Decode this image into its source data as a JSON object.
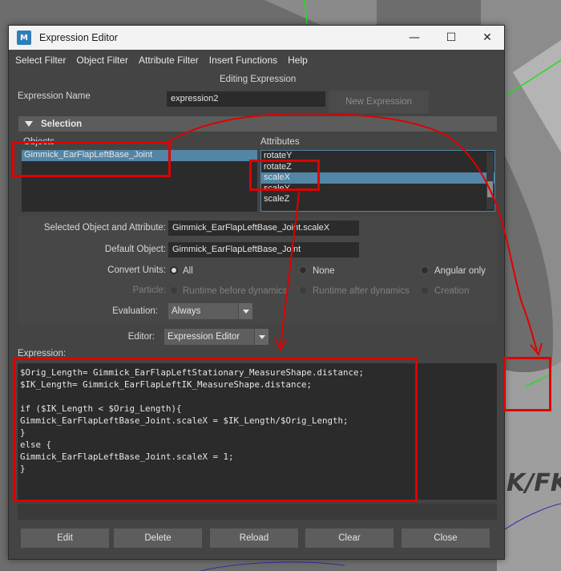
{
  "window": {
    "title": "Expression Editor",
    "app_icon": "M",
    "controls": {
      "minimize": "—",
      "maximize": "☐",
      "close": "✕"
    }
  },
  "menu": [
    "Select Filter",
    "Object Filter",
    "Attribute Filter",
    "Insert Functions",
    "Help"
  ],
  "header": {
    "editing_label": "Editing Expression"
  },
  "expression_name": {
    "label": "Expression Name",
    "value": "expression2",
    "new_button": "New Expression"
  },
  "selection": {
    "title": "Selection",
    "objects_label": "Objects",
    "objects": [
      "Gimmick_EarFlapLeftBase_Joint"
    ],
    "attributes_label": "Attributes",
    "attributes": [
      "rotateY",
      "rotateZ",
      "scaleX",
      "scaleY",
      "scaleZ"
    ],
    "selected_attribute": "scaleX"
  },
  "details": {
    "selected_label": "Selected Object and Attribute:",
    "selected_value": "Gimmick_EarFlapLeftBase_Joint.scaleX",
    "default_label": "Default Object:",
    "default_value": "Gimmick_EarFlapLeftBase_Joint",
    "convert_units_label": "Convert Units:",
    "convert_units_options": [
      "All",
      "None",
      "Angular only"
    ],
    "particle_label": "Particle:",
    "particle_options": [
      "Runtime before dynamics",
      "Runtime after dynamics",
      "Creation"
    ],
    "evaluation_label": "Evaluation:",
    "evaluation_value": "Always",
    "editor_label": "Editor:",
    "editor_value": "Expression Editor"
  },
  "expression": {
    "label": "Expression:",
    "code": "$Orig_Length= Gimmick_EarFlapLeftStationary_MeasureShape.distance;\n$IK_Length= Gimmick_EarFlapLeftIK_MeasureShape.distance;\n\nif ($IK_Length < $Orig_Length){\nGimmick_EarFlapLeftBase_Joint.scaleX = $IK_Length/$Orig_Length;\n}\nelse {\nGimmick_EarFlapLeftBase_Joint.scaleX = 1;\n}"
  },
  "buttons": [
    "Edit",
    "Delete",
    "Reload",
    "Clear",
    "Close"
  ],
  "viewport": {
    "overlay_text": "K/FK"
  },
  "colors": {
    "annotation": "#e00000",
    "selection": "#5285a6",
    "viewport_line": "#22dd22"
  }
}
